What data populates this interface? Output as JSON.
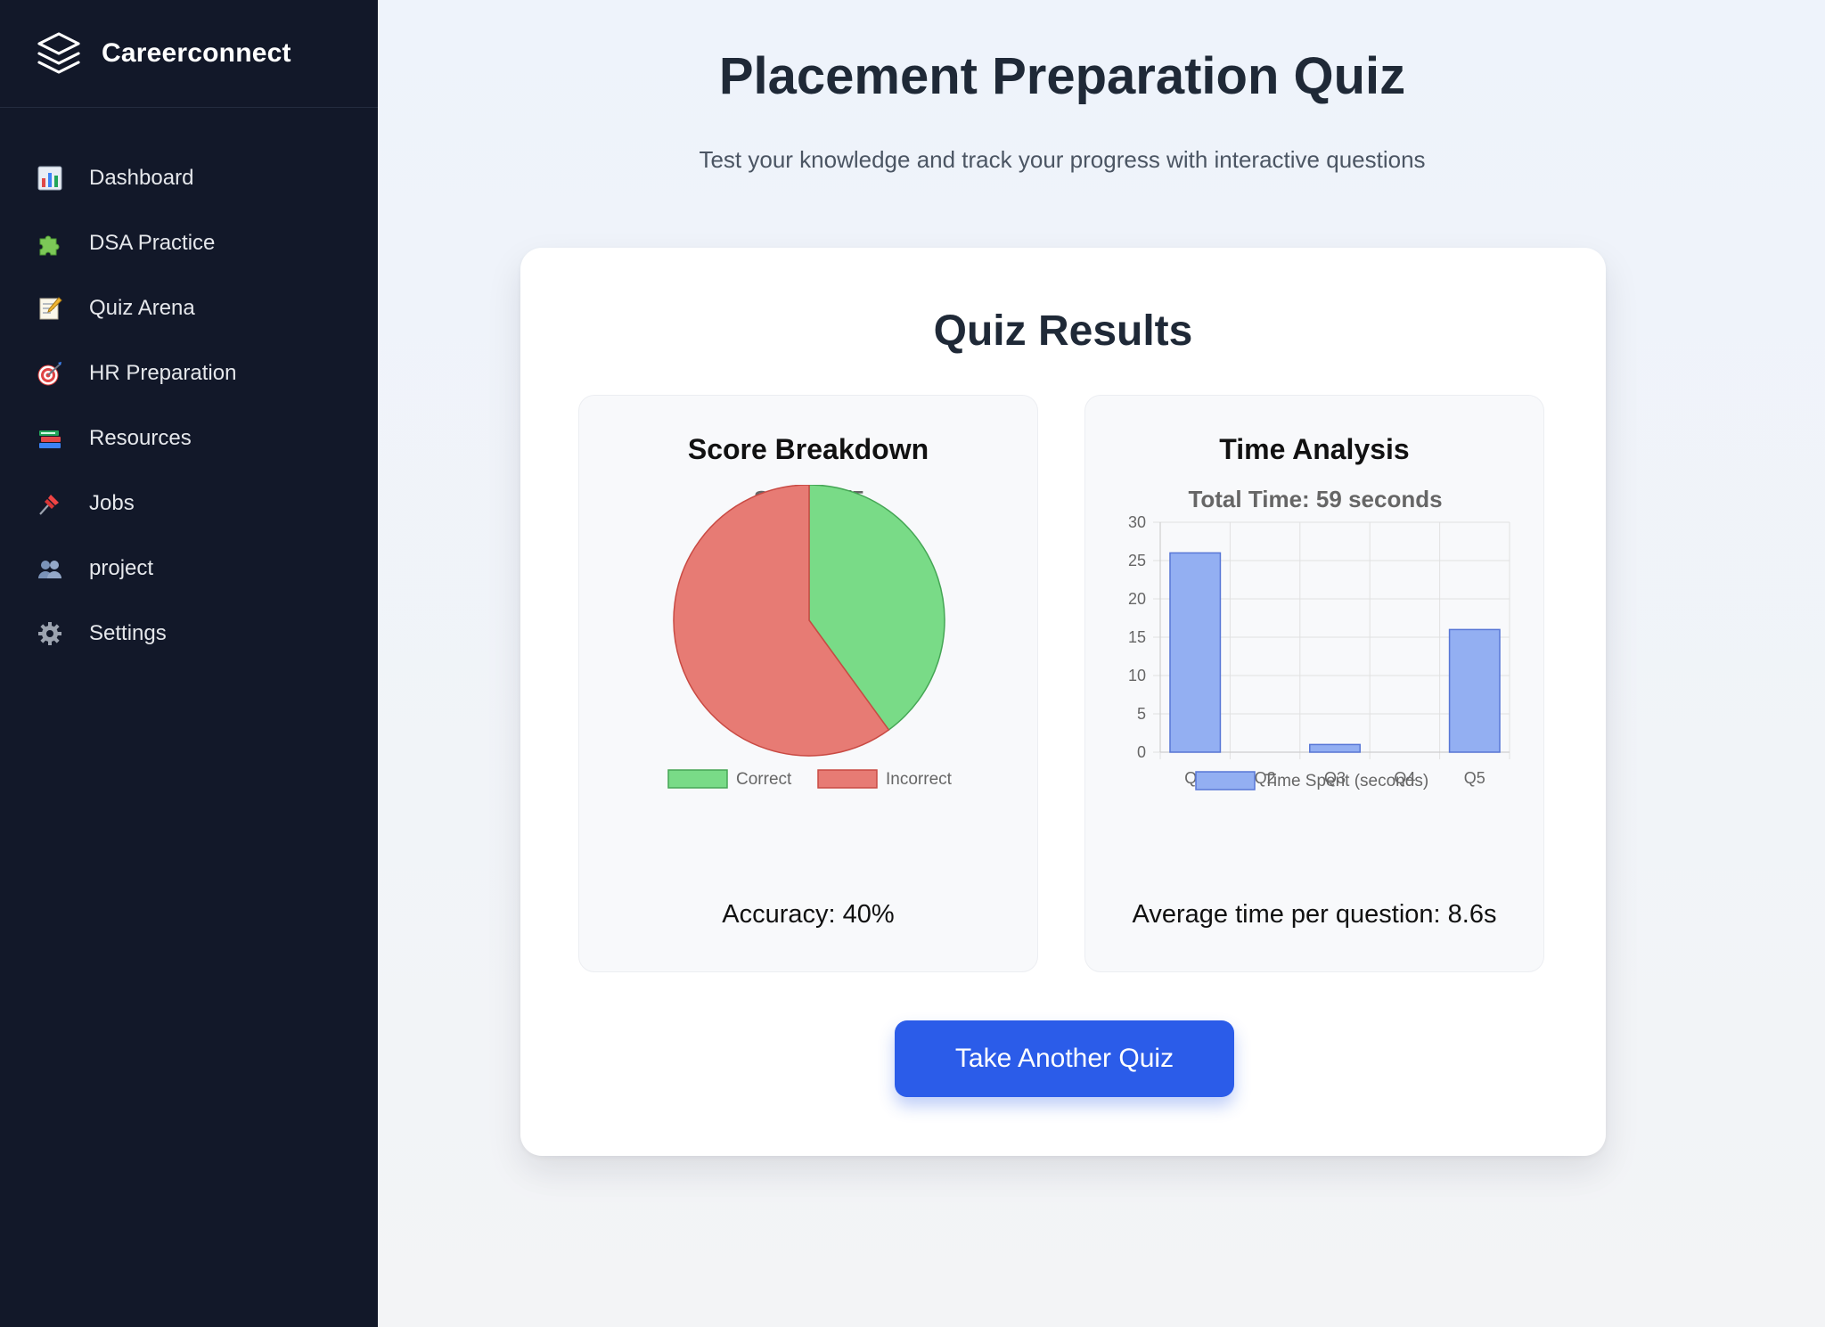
{
  "app": {
    "brand": "Careerconnect"
  },
  "sidebar": {
    "items": [
      {
        "label": "Dashboard",
        "icon": "bar-chart-icon"
      },
      {
        "label": "DSA Practice",
        "icon": "puzzle-piece-icon"
      },
      {
        "label": "Quiz Arena",
        "icon": "memo-icon"
      },
      {
        "label": "HR Preparation",
        "icon": "target-icon"
      },
      {
        "label": "Resources",
        "icon": "books-icon"
      },
      {
        "label": "Jobs",
        "icon": "pushpin-icon"
      },
      {
        "label": "project",
        "icon": "people-icon"
      },
      {
        "label": "Settings",
        "icon": "gear-icon"
      }
    ]
  },
  "main": {
    "title": "Placement Preparation Quiz",
    "subtitle": "Test your knowledge and track your progress with interactive questions",
    "results": {
      "title": "Quiz Results",
      "score_panel": {
        "title": "Score Breakdown",
        "accuracy": "Accuracy: 40%"
      },
      "time_panel": {
        "title": "Time Analysis",
        "average": "Average time per question: 8.6s"
      },
      "button_label": "Take Another Quiz"
    }
  },
  "colors": {
    "sidebar_bg": "#121829",
    "accent": "#2b5ce9",
    "correct": "#79db87",
    "incorrect": "#e77b74",
    "bar": "#93aff2"
  },
  "chart_data": [
    {
      "type": "pie",
      "title": "Score: 2/5",
      "labels": [
        "Correct",
        "Incorrect"
      ],
      "values": [
        2,
        3
      ],
      "colors": [
        "#79db87",
        "#e77b74"
      ],
      "border_colors": [
        "#45a655",
        "#c94a43"
      ],
      "legend": "bottom"
    },
    {
      "type": "bar",
      "title": "Total Time: 59 seconds",
      "categories": [
        "Q1",
        "Q2",
        "Q3",
        "Q4",
        "Q5"
      ],
      "series": [
        {
          "name": "Time Spent (seconds)",
          "values": [
            26,
            0,
            1,
            0,
            16
          ]
        }
      ],
      "ylim": [
        0,
        30
      ],
      "yticks": [
        0,
        5,
        10,
        15,
        20,
        25,
        30
      ],
      "grid": true,
      "legend": "bottom",
      "color": "#93aff2",
      "border_color": "#5877d6"
    }
  ]
}
